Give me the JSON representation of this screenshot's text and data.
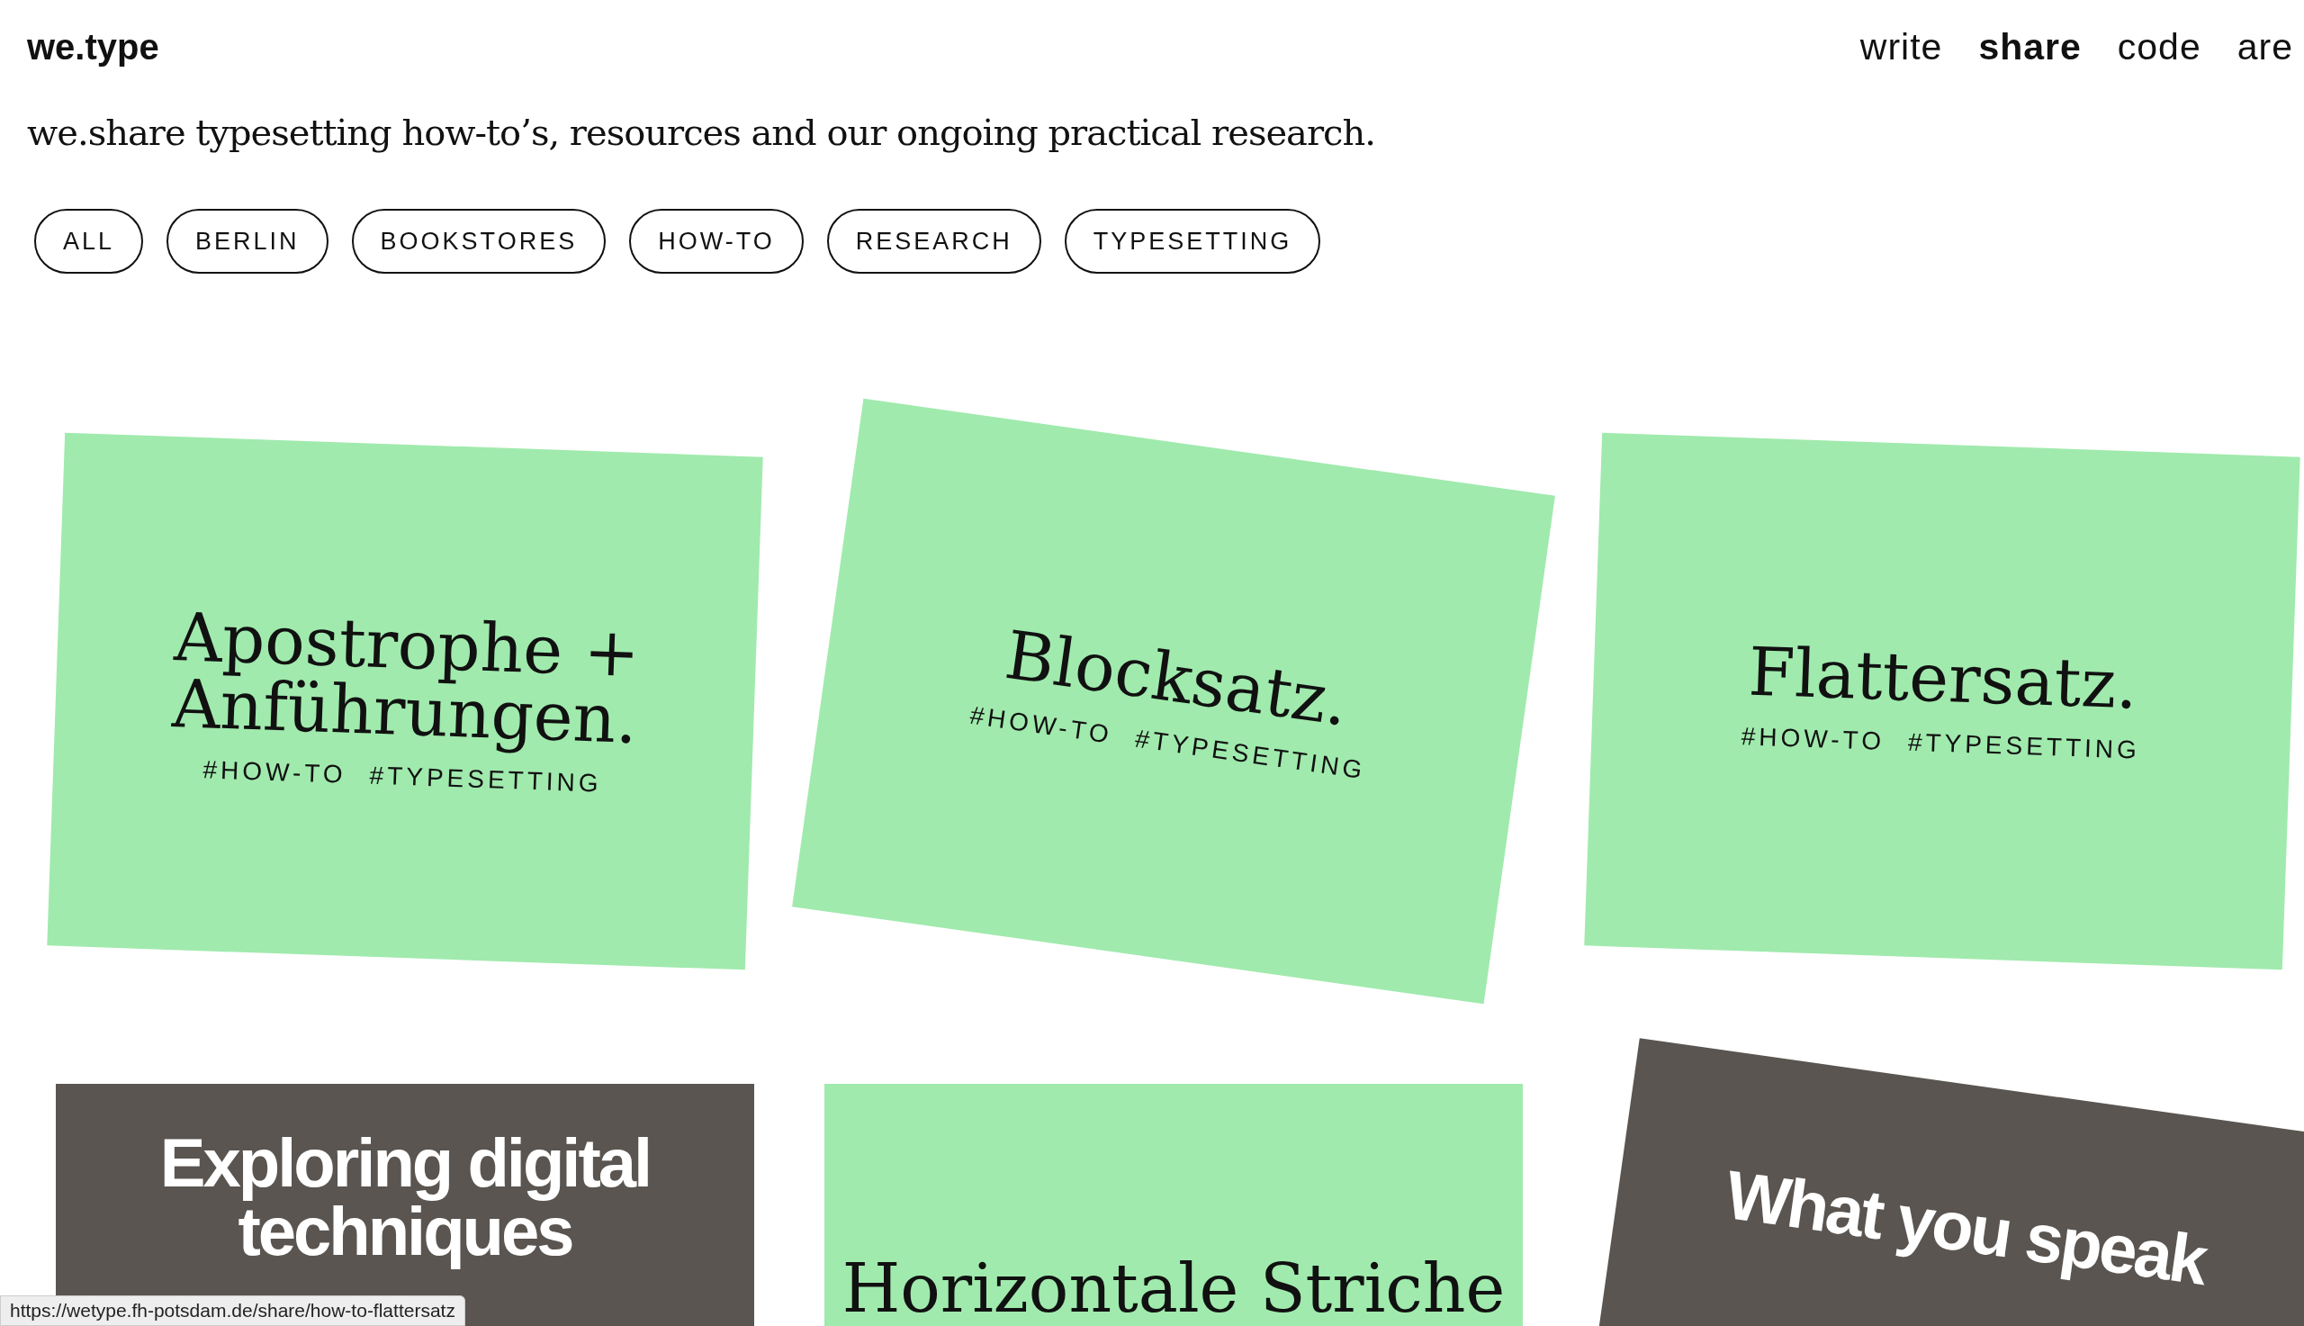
{
  "header": {
    "brand": "we.type",
    "nav": [
      {
        "label": "write",
        "selected": false
      },
      {
        "label": "share",
        "selected": true
      },
      {
        "label": "code",
        "selected": false
      },
      {
        "label": "are",
        "selected": false
      }
    ]
  },
  "tagline": "we.share typesetting how-to’s, resources and our ongoing practical research.",
  "filters": [
    "ALL",
    "BERLIN",
    "BOOKSTORES",
    "HOW-TO",
    "RESEARCH",
    "TYPESETTING"
  ],
  "cards": [
    {
      "kind": "text",
      "title_lines": [
        "Apostrophe +",
        "Anführungen."
      ],
      "tags": [
        "#HOW-TO",
        "#TYPESETTING"
      ]
    },
    {
      "kind": "text",
      "title_lines": [
        "Blocksatz."
      ],
      "tags": [
        "#HOW-TO",
        "#TYPESETTING"
      ]
    },
    {
      "kind": "text",
      "title_lines": [
        "Flattersatz."
      ],
      "tags": [
        "#HOW-TO",
        "#TYPESETTING"
      ]
    },
    {
      "kind": "photo",
      "title_lines": [
        "Exploring digital",
        "techniques"
      ]
    },
    {
      "kind": "text",
      "title_lines": [
        "Horizontale Striche"
      ]
    },
    {
      "kind": "photo",
      "title_lines": [
        "What you speak"
      ]
    }
  ],
  "status_url": "https://wetype.fh-potsdam.de/share/how-to-flattersatz"
}
